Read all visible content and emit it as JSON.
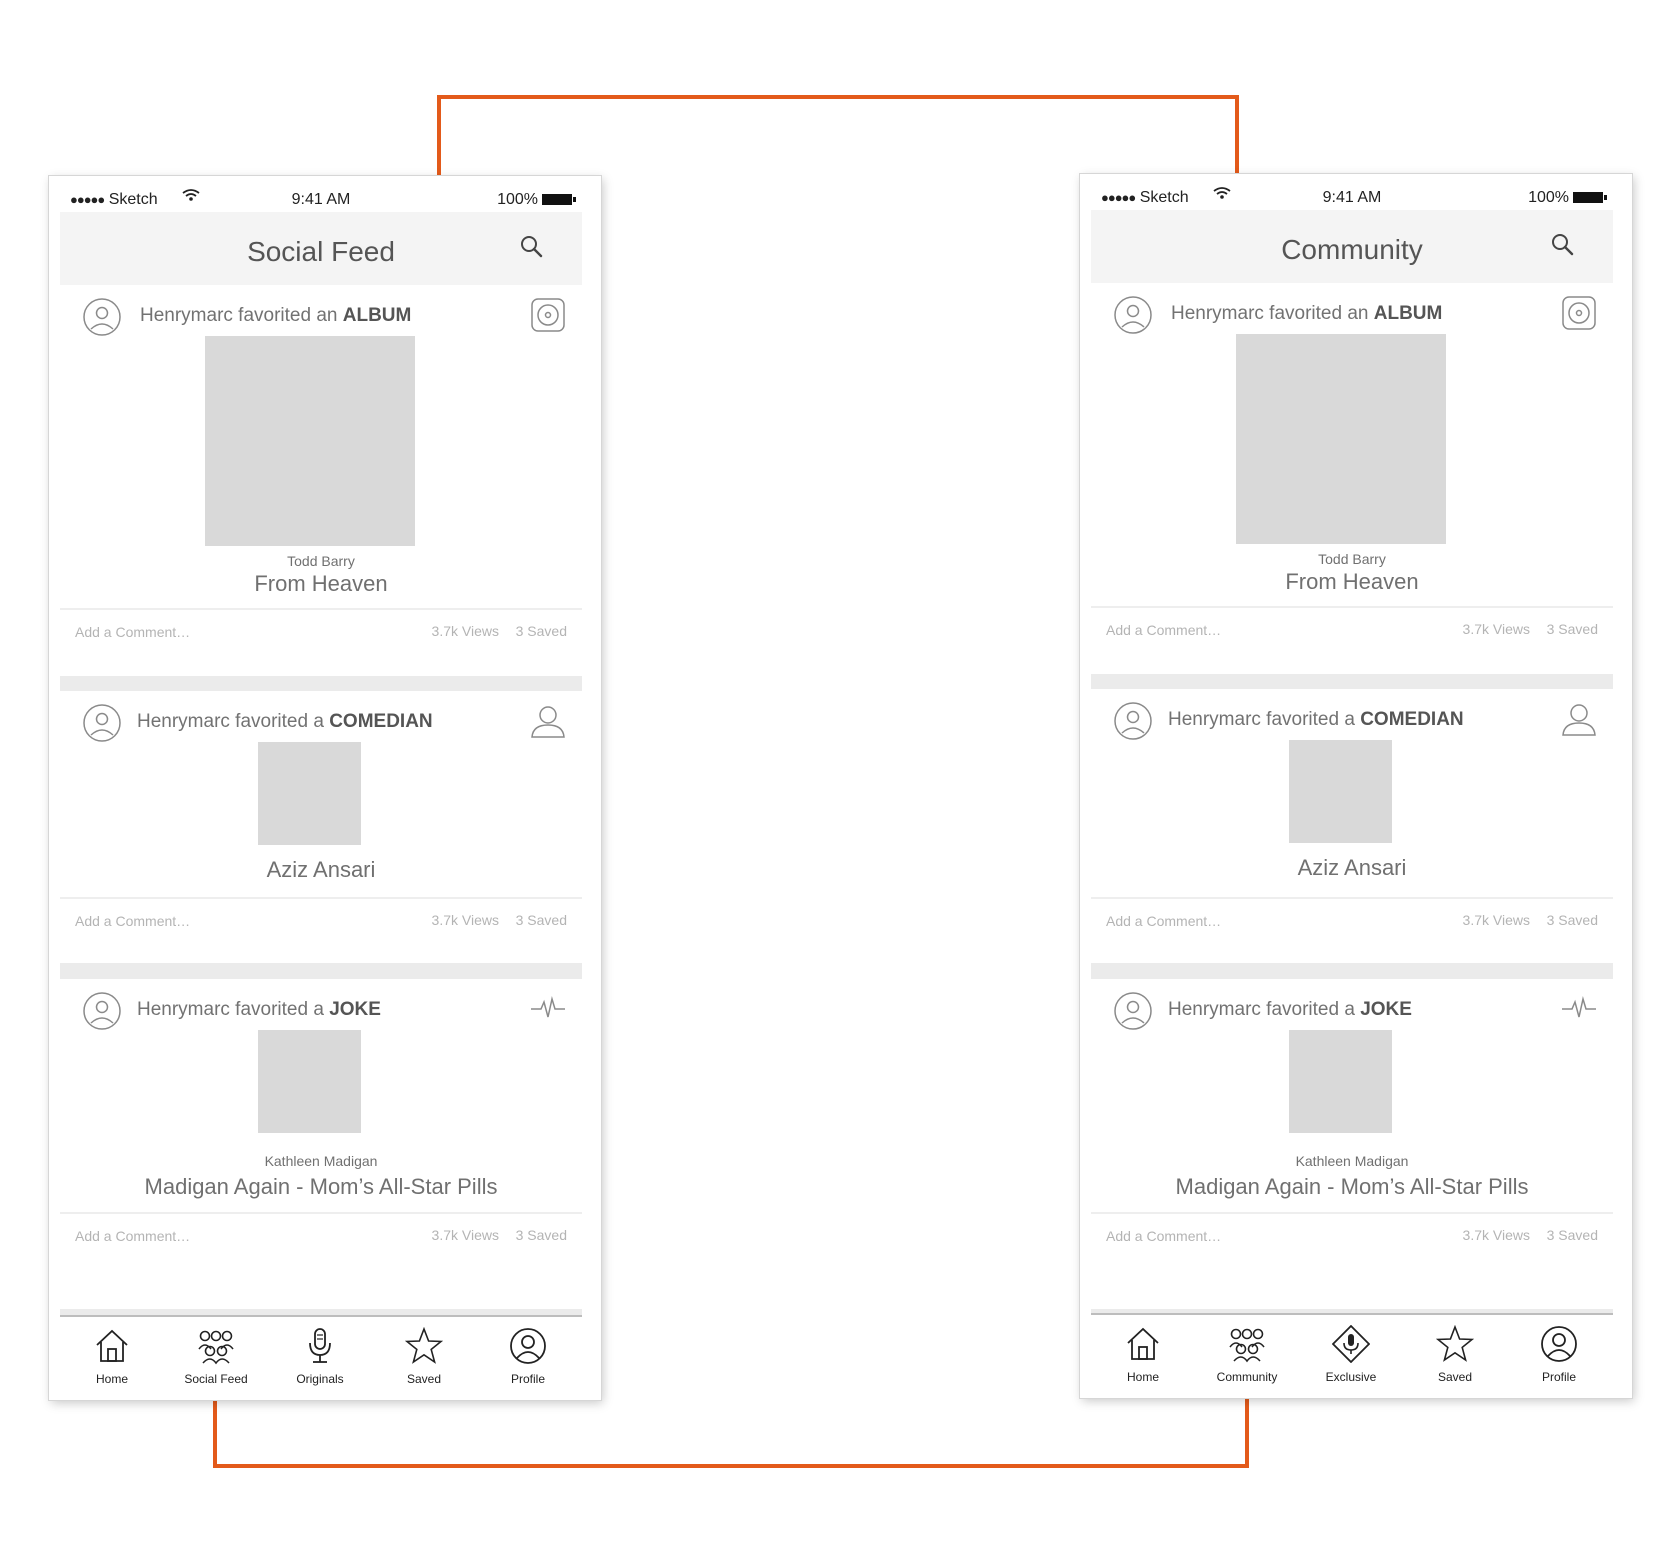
{
  "colors": {
    "connector": "#E35A1A",
    "placeholder": "#D9D9D9",
    "navbar": "#F4F4F4",
    "separator": "#EBEBEB"
  },
  "screens": [
    {
      "status": {
        "carrier_dots": "●●●●●",
        "carrier": "Sketch",
        "time": "9:41 AM",
        "battery": "100%"
      },
      "nav_title": "Social Feed",
      "cards": [
        {
          "prefix": "Henrymarc favorited an ",
          "type": "ALBUM",
          "icon": "album-icon",
          "artist": "Todd Barry",
          "title": "From Heaven",
          "comment_placeholder": "Add a Comment…",
          "views": "3.7k Views",
          "saved": "3 Saved"
        },
        {
          "prefix": "Henrymarc favorited a ",
          "type": "COMEDIAN",
          "icon": "person-icon",
          "artist": "",
          "title": "Aziz Ansari",
          "comment_placeholder": "Add a Comment…",
          "views": "3.7k Views",
          "saved": "3 Saved"
        },
        {
          "prefix": "Henrymarc favorited a ",
          "type": "JOKE",
          "icon": "pulse-icon",
          "artist": "Kathleen Madigan",
          "title": "Madigan Again - Mom’s All-Star Pills",
          "comment_placeholder": "Add a Comment…",
          "views": "3.7k Views",
          "saved": "3 Saved"
        }
      ],
      "tabs": [
        {
          "label": "Home",
          "icon": "home-icon"
        },
        {
          "label": "Social Feed",
          "icon": "group-icon"
        },
        {
          "label": "Originals",
          "icon": "microphone-icon"
        },
        {
          "label": "Saved",
          "icon": "star-icon"
        },
        {
          "label": "Profile",
          "icon": "profile-icon"
        }
      ]
    },
    {
      "status": {
        "carrier_dots": "●●●●●",
        "carrier": "Sketch",
        "time": "9:41 AM",
        "battery": "100%"
      },
      "nav_title": "Community",
      "cards": [
        {
          "prefix": "Henrymarc favorited an ",
          "type": "ALBUM",
          "icon": "album-icon",
          "artist": "Todd Barry",
          "title": "From Heaven",
          "comment_placeholder": "Add a Comment…",
          "views": "3.7k Views",
          "saved": "3 Saved"
        },
        {
          "prefix": "Henrymarc favorited a ",
          "type": "COMEDIAN",
          "icon": "person-icon",
          "artist": "",
          "title": "Aziz Ansari",
          "comment_placeholder": "Add a Comment…",
          "views": "3.7k Views",
          "saved": "3 Saved"
        },
        {
          "prefix": "Henrymarc favorited a ",
          "type": "JOKE",
          "icon": "pulse-icon",
          "artist": "Kathleen Madigan",
          "title": "Madigan Again - Mom’s All-Star Pills",
          "comment_placeholder": "Add a Comment…",
          "views": "3.7k Views",
          "saved": "3 Saved"
        }
      ],
      "tabs": [
        {
          "label": "Home",
          "icon": "home-icon"
        },
        {
          "label": "Community",
          "icon": "group-icon"
        },
        {
          "label": "Exclusive",
          "icon": "exclusive-microphone-icon"
        },
        {
          "label": "Saved",
          "icon": "star-icon"
        },
        {
          "label": "Profile",
          "icon": "profile-icon"
        }
      ]
    }
  ]
}
